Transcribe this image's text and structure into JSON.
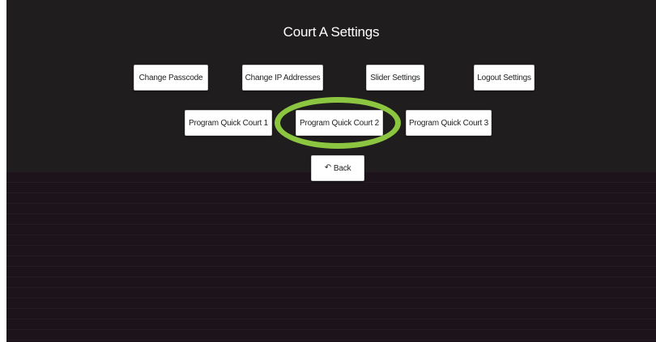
{
  "page": {
    "title": "Court A Settings"
  },
  "buttons": {
    "change_passcode": "Change Passcode",
    "change_ip_addresses": "Change IP Addresses",
    "slider_settings": "Slider Settings",
    "logout_settings": "Logout Settings",
    "program_quick_court_1": "Program Quick Court 1",
    "program_quick_court_2": "Program Quick Court 2",
    "program_quick_court_3": "Program Quick Court 3",
    "back": "Back"
  },
  "icons": {
    "back_icon": "reply-arrow-icon"
  },
  "colors": {
    "screen_background": "#201d1e",
    "lower_panel": "#1c141a",
    "highlight": "#8cc640",
    "button_background": "#ffffff"
  }
}
